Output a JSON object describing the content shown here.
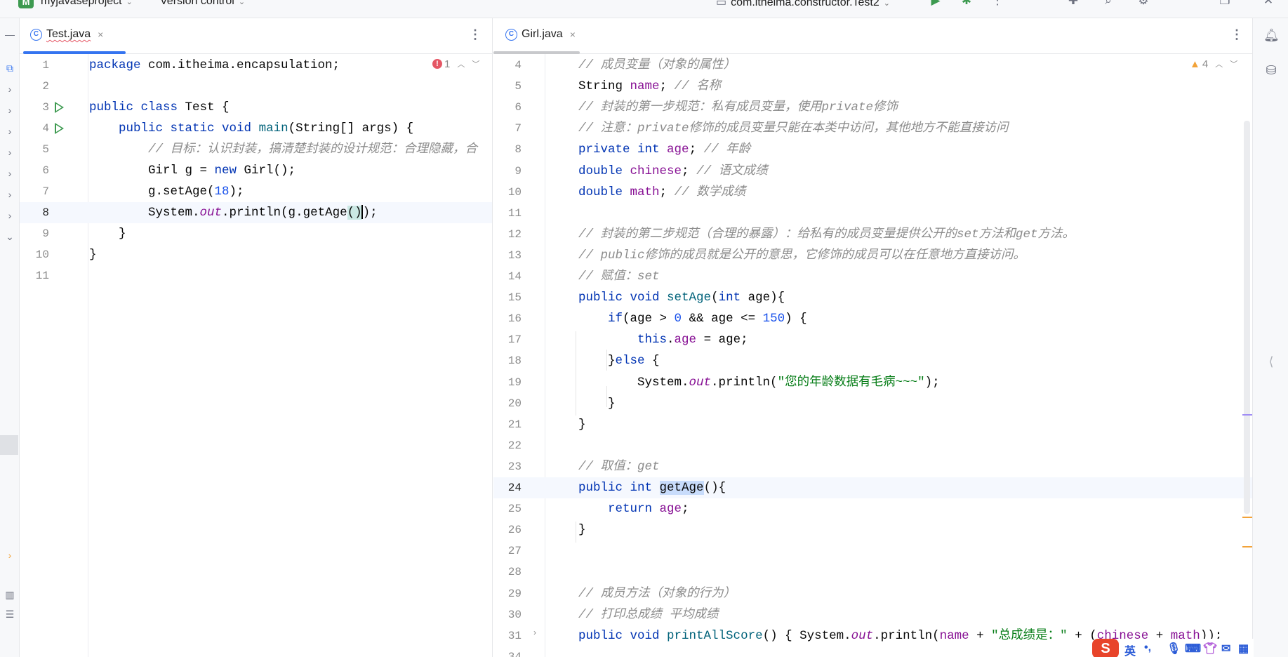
{
  "titlebar": {
    "project_badge": "M",
    "project_name": "myjavaseproject",
    "vcs": "Version control",
    "run_config": "com.itheima.constructor.Test2"
  },
  "left_editor": {
    "tab": {
      "icon": "C",
      "label": "Test.java",
      "close": "×"
    },
    "menu": "⋮",
    "inspections": {
      "errors": "1"
    },
    "lines": [
      {
        "n": "1",
        "segs": [
          [
            "k",
            "package"
          ],
          [
            "t",
            " com.itheima.encapsulation;"
          ]
        ]
      },
      {
        "n": "2",
        "segs": []
      },
      {
        "n": "3",
        "segs": [
          [
            "k",
            "public class"
          ],
          [
            "t",
            " Test {"
          ]
        ]
      },
      {
        "n": "4",
        "segs": [
          [
            "t",
            "    "
          ],
          [
            "k",
            "public static void"
          ],
          [
            "t",
            " "
          ],
          [
            "fn",
            "main"
          ],
          [
            "t",
            "(String[] args) {"
          ]
        ]
      },
      {
        "n": "5",
        "segs": [
          [
            "t",
            "        "
          ],
          [
            "cm",
            "// 目标：认识封装，搞清楚封装的设计规范：合理隐藏，合"
          ]
        ]
      },
      {
        "n": "6",
        "segs": [
          [
            "t",
            "        Girl g = "
          ],
          [
            "k",
            "new"
          ],
          [
            "t",
            " Girl();"
          ]
        ]
      },
      {
        "n": "7",
        "segs": [
          [
            "t",
            "        g.setAge("
          ],
          [
            "num",
            "18"
          ],
          [
            "t",
            ");"
          ]
        ]
      },
      {
        "n": "8",
        "segs": [
          [
            "t",
            "        System."
          ],
          [
            "st",
            "out"
          ],
          [
            "t",
            ".println(g.getAge"
          ],
          [
            "hl",
            "()"
          ],
          [
            "caret",
            ""
          ],
          [
            "t",
            ");"
          ]
        ]
      },
      {
        "n": "9",
        "segs": [
          [
            "t",
            "    }"
          ]
        ]
      },
      {
        "n": "10",
        "segs": [
          [
            "t",
            "}"
          ]
        ]
      },
      {
        "n": "11",
        "segs": []
      }
    ]
  },
  "right_editor": {
    "tab": {
      "icon": "C",
      "label": "Girl.java",
      "close": "×"
    },
    "menu": "⋮",
    "inspections": {
      "warnings": "4"
    },
    "lines": [
      {
        "n": "4",
        "segs": [
          [
            "cm",
            "// 成员变量（对象的属性）"
          ]
        ]
      },
      {
        "n": "5",
        "segs": [
          [
            "t",
            "String "
          ],
          [
            "fld",
            "name"
          ],
          [
            "t",
            "; "
          ],
          [
            "cm",
            "// 名称"
          ]
        ]
      },
      {
        "n": "6",
        "segs": [
          [
            "cm",
            "// 封装的第一步规范：私有成员变量，使用private修饰"
          ]
        ]
      },
      {
        "n": "7",
        "segs": [
          [
            "cm",
            "// 注意：private修饰的成员变量只能在本类中访问，其他地方不能直接访问"
          ]
        ]
      },
      {
        "n": "8",
        "segs": [
          [
            "k",
            "private int"
          ],
          [
            "t",
            " "
          ],
          [
            "fld",
            "age"
          ],
          [
            "t",
            "; "
          ],
          [
            "cm",
            "// 年龄"
          ]
        ]
      },
      {
        "n": "9",
        "segs": [
          [
            "k",
            "double"
          ],
          [
            "t",
            " "
          ],
          [
            "fld",
            "chinese"
          ],
          [
            "t",
            "; "
          ],
          [
            "cm",
            "// 语文成绩"
          ]
        ]
      },
      {
        "n": "10",
        "segs": [
          [
            "k",
            "double"
          ],
          [
            "t",
            " "
          ],
          [
            "fld",
            "math"
          ],
          [
            "t",
            "; "
          ],
          [
            "cm",
            "// 数学成绩"
          ]
        ]
      },
      {
        "n": "11",
        "segs": []
      },
      {
        "n": "12",
        "segs": [
          [
            "cm",
            "// 封装的第二步规范（合理的暴露）：给私有的成员变量提供公开的set方法和get方法。"
          ]
        ]
      },
      {
        "n": "13",
        "segs": [
          [
            "cm",
            "// public修饰的成员就是公开的意思，它修饰的成员可以在任意地方直接访问。"
          ]
        ]
      },
      {
        "n": "14",
        "segs": [
          [
            "cm",
            "// 赋值：set"
          ]
        ]
      },
      {
        "n": "15",
        "segs": [
          [
            "k",
            "public void"
          ],
          [
            "t",
            " "
          ],
          [
            "fn",
            "setAge"
          ],
          [
            "t",
            "("
          ],
          [
            "k",
            "int"
          ],
          [
            "t",
            " age){"
          ]
        ]
      },
      {
        "n": "16",
        "segs": [
          [
            "t",
            "    "
          ],
          [
            "k",
            "if"
          ],
          [
            "t",
            "(age > "
          ],
          [
            "num",
            "0"
          ],
          [
            "t",
            " && age <= "
          ],
          [
            "num",
            "150"
          ],
          [
            "t",
            ") {"
          ]
        ]
      },
      {
        "n": "17",
        "segs": [
          [
            "t",
            "        "
          ],
          [
            "k",
            "this"
          ],
          [
            "t",
            "."
          ],
          [
            "fld",
            "age"
          ],
          [
            "t",
            " = age;"
          ]
        ]
      },
      {
        "n": "18",
        "segs": [
          [
            "t",
            "    }"
          ],
          [
            "k",
            "else"
          ],
          [
            "t",
            " {"
          ]
        ]
      },
      {
        "n": "19",
        "segs": [
          [
            "t",
            "        System."
          ],
          [
            "st",
            "out"
          ],
          [
            "t",
            ".println("
          ],
          [
            "s",
            "\"您的年龄数据有毛病~~~\""
          ],
          [
            "t",
            ");"
          ]
        ]
      },
      {
        "n": "20",
        "segs": [
          [
            "t",
            "    }"
          ]
        ]
      },
      {
        "n": "21",
        "segs": [
          [
            "t",
            "}"
          ]
        ]
      },
      {
        "n": "22",
        "segs": []
      },
      {
        "n": "23",
        "segs": [
          [
            "cm",
            "// 取值：get"
          ]
        ]
      },
      {
        "n": "24",
        "segs": [
          [
            "k",
            "public int"
          ],
          [
            "t",
            " "
          ],
          [
            "hlsel",
            "getAge"
          ],
          [
            "t",
            "(){"
          ]
        ]
      },
      {
        "n": "25",
        "segs": [
          [
            "t",
            "    "
          ],
          [
            "k",
            "return"
          ],
          [
            "t",
            " "
          ],
          [
            "fld",
            "age"
          ],
          [
            "t",
            ";"
          ]
        ]
      },
      {
        "n": "26",
        "segs": [
          [
            "t",
            "}"
          ]
        ]
      },
      {
        "n": "27",
        "segs": []
      },
      {
        "n": "28",
        "segs": []
      },
      {
        "n": "29",
        "segs": [
          [
            "cm",
            "// 成员方法（对象的行为）"
          ]
        ]
      },
      {
        "n": "30",
        "segs": [
          [
            "cm",
            "// 打印总成绩 平均成绩"
          ]
        ]
      },
      {
        "n": "31",
        "segs": [
          [
            "k",
            "public void"
          ],
          [
            "t",
            " "
          ],
          [
            "fn",
            "printAllScore"
          ],
          [
            "t",
            "() { System."
          ],
          [
            "st",
            "out"
          ],
          [
            "t",
            ".println("
          ],
          [
            "fld",
            "name"
          ],
          [
            "t",
            " + "
          ],
          [
            "s",
            "\"总成绩是：\""
          ],
          [
            "t",
            " + ("
          ],
          [
            "fld",
            "chinese"
          ],
          [
            "t",
            " + "
          ],
          [
            "fld",
            "math"
          ],
          [
            "t",
            "));"
          ]
        ]
      },
      {
        "n": "34",
        "segs": []
      }
    ]
  },
  "ime": {
    "logo": "S",
    "lang": "英",
    "punct": "•,"
  },
  "colors": {
    "accent": "#3574f0",
    "run": "#3d9a50",
    "error": "#e55765",
    "warning": "#f2a33a"
  }
}
